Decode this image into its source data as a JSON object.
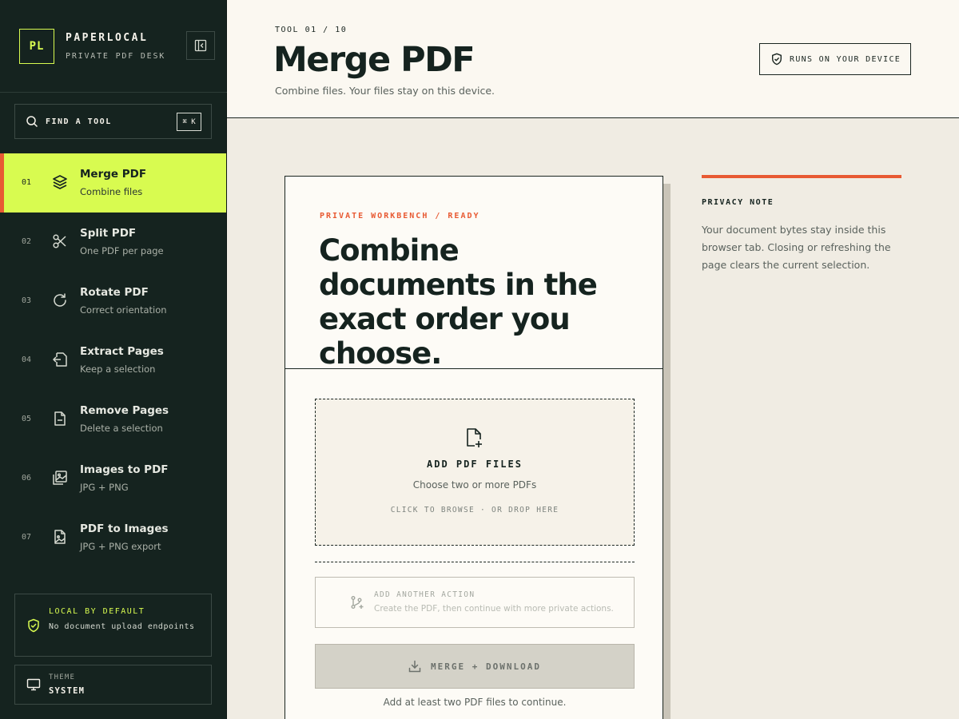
{
  "brand": {
    "logo": "PL",
    "name": "PAPERLOCAL",
    "tagline": "PRIVATE PDF DESK"
  },
  "search": {
    "label": "FIND A TOOL",
    "shortcut": "⌘ K"
  },
  "nav": [
    {
      "num": "01",
      "title": "Merge PDF",
      "sub": "Combine files",
      "icon": "layers-icon",
      "active": true
    },
    {
      "num": "02",
      "title": "Split PDF",
      "sub": "One PDF per page",
      "icon": "scissors-icon"
    },
    {
      "num": "03",
      "title": "Rotate PDF",
      "sub": "Correct orientation",
      "icon": "rotate-icon"
    },
    {
      "num": "04",
      "title": "Extract Pages",
      "sub": "Keep a selection",
      "icon": "extract-icon"
    },
    {
      "num": "05",
      "title": "Remove Pages",
      "sub": "Delete a selection",
      "icon": "file-remove-icon"
    },
    {
      "num": "06",
      "title": "Images to PDF",
      "sub": "JPG + PNG",
      "icon": "image-icon"
    },
    {
      "num": "07",
      "title": "PDF to Images",
      "sub": "JPG + PNG export",
      "icon": "file-image-icon"
    }
  ],
  "local": {
    "title": "LOCAL BY DEFAULT",
    "sub": "No document upload endpoints"
  },
  "theme": {
    "label": "THEME",
    "value": "SYSTEM"
  },
  "header": {
    "tool_count": "TOOL 01 / 10",
    "title": "Merge PDF",
    "subtitle": "Combine files. Your files stay on this device.",
    "badge": "RUNS ON YOUR DEVICE"
  },
  "card": {
    "eyebrow": "PRIVATE WORKBENCH / READY",
    "headline": "Combine documents in the exact order you choose.",
    "dropzone": {
      "title": "ADD PDF FILES",
      "sub": "Choose two or more PDFs",
      "hint": "CLICK TO BROWSE · OR DROP HERE"
    },
    "action": {
      "title": "ADD ANOTHER ACTION",
      "sub": "Create the PDF, then continue with more private actions."
    },
    "merge_button": "MERGE + DOWNLOAD",
    "merge_hint": "Add at least two PDF files to continue."
  },
  "privacy": {
    "title": "PRIVACY NOTE",
    "text": "Your document bytes stay inside this browser tab. Closing or refreshing the page clears the current selection."
  },
  "colors": {
    "accent": "#d8fb50",
    "alert": "#e85a33",
    "sidebar": "#15231f",
    "page": "#f0ece3"
  }
}
